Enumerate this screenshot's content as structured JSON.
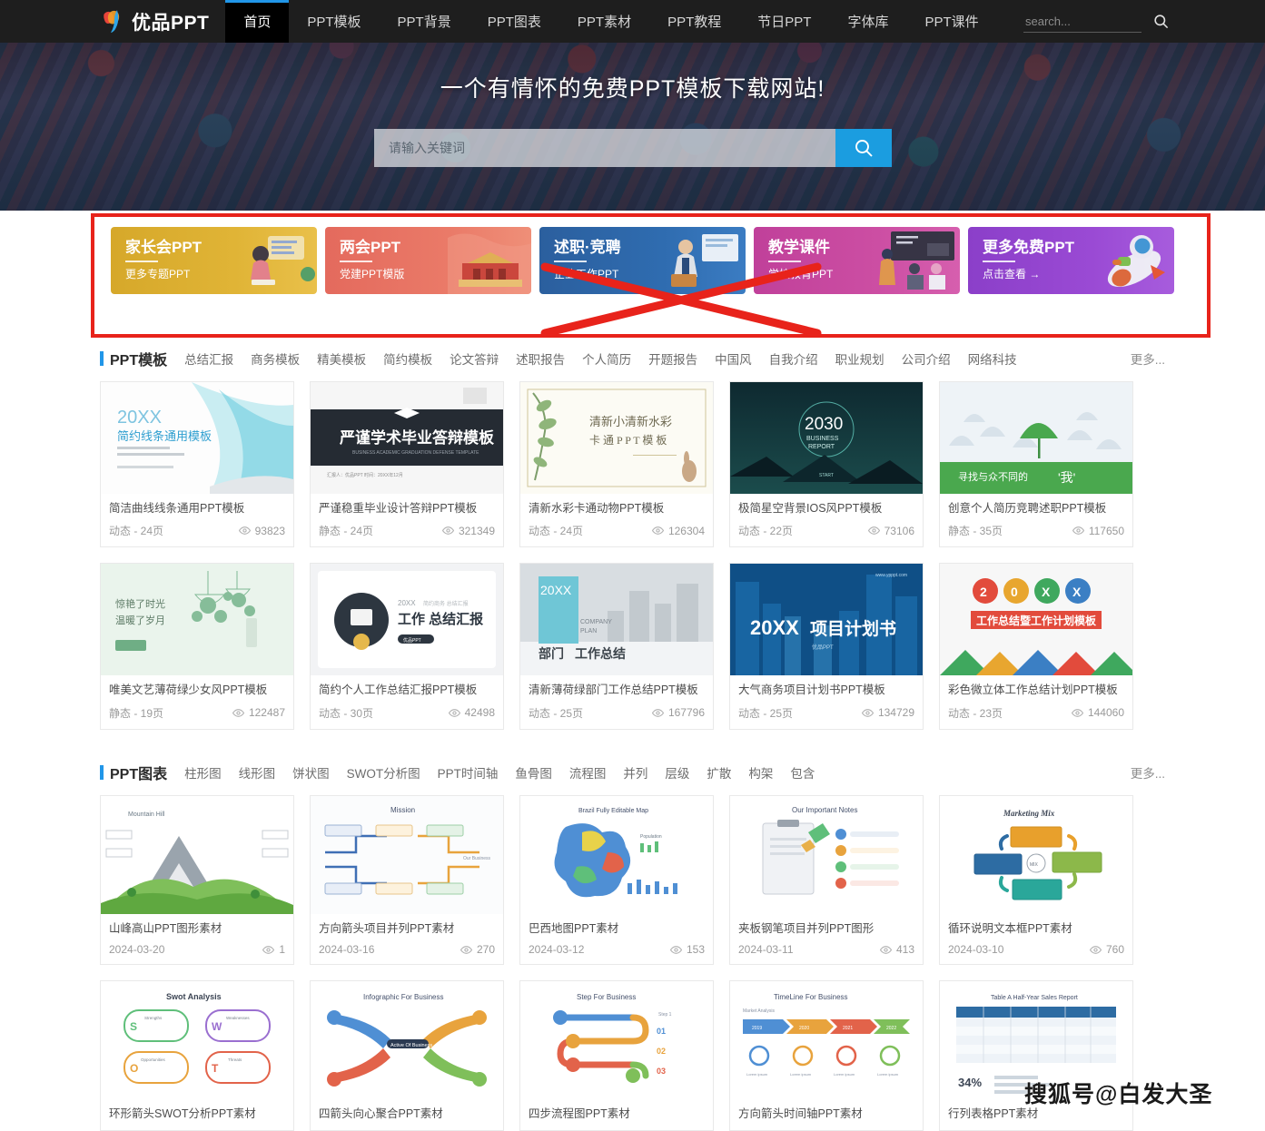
{
  "site": {
    "logo_text": "优品PPT",
    "logo_icon": "logo-mark-icon"
  },
  "topnav": {
    "items": [
      {
        "label": "首页",
        "active": true
      },
      {
        "label": "PPT模板",
        "active": false
      },
      {
        "label": "PPT背景",
        "active": false
      },
      {
        "label": "PPT图表",
        "active": false
      },
      {
        "label": "PPT素材",
        "active": false
      },
      {
        "label": "PPT教程",
        "active": false
      },
      {
        "label": "节日PPT",
        "active": false
      },
      {
        "label": "字体库",
        "active": false
      },
      {
        "label": "PPT课件",
        "active": false
      }
    ],
    "search_placeholder": "search...",
    "search_value": "",
    "search_icon": "search-icon"
  },
  "hero": {
    "title": "一个有情怀的免费PPT模板下载网站!",
    "search_placeholder": "请输入关键词",
    "search_value": "",
    "search_icon": "search-icon"
  },
  "promos": [
    {
      "title": "家长会PPT",
      "sub": "更多专题PPT",
      "color": "#dfb133",
      "art": "woman-laptop-icon"
    },
    {
      "title": "两会PPT",
      "sub": "党建PPT模版",
      "color": "#ea7a68",
      "art": "tiananmen-icon"
    },
    {
      "title": "述职·竞聘",
      "sub": "企业工作PPT",
      "color": "#2f6cb0",
      "art": "businessman-icon"
    },
    {
      "title": "教学课件",
      "sub": "学校教育PPT",
      "color": "#cc4ea3",
      "art": "classroom-icon"
    },
    {
      "title": "更多免费PPT",
      "sub": "点击查看 →",
      "color": "#9a4ad4",
      "art": "astronaut-rocket-icon"
    }
  ],
  "annotation": {
    "box_color": "#e8231b",
    "cross_color": "#e8231b"
  },
  "blocks": [
    {
      "title": "PPT模板",
      "tags": [
        "总结汇报",
        "商务模板",
        "精美模板",
        "简约模板",
        "论文答辩",
        "述职报告",
        "个人简历",
        "开题报告",
        "中国风",
        "自我介绍",
        "职业规划",
        "公司介绍",
        "网络科技"
      ],
      "more": "更多...",
      "cards": [
        {
          "title": "简洁曲线线条通用PPT模板",
          "meta": "动态 - 24页",
          "views": "93823",
          "thumb": "curve-lines-blue"
        },
        {
          "title": "严谨稳重毕业设计答辩PPT模板",
          "meta": "静态 - 24页",
          "views": "321349",
          "thumb": "graduation-dark"
        },
        {
          "title": "清新水彩卡通动物PPT模板",
          "meta": "动态 - 24页",
          "views": "126304",
          "thumb": "watercolor-animal"
        },
        {
          "title": "极简星空背景IOS风PPT模板",
          "meta": "动态 - 22页",
          "views": "73106",
          "thumb": "starry-2030"
        },
        {
          "title": "创意个人简历竞聘述职PPT模板",
          "meta": "静态 - 35页",
          "views": "117650",
          "thumb": "green-umbrella"
        },
        {
          "title": "唯美文艺薄荷绿少女风PPT模板",
          "meta": "静态 - 19页",
          "views": "122487",
          "thumb": "mint-girl"
        },
        {
          "title": "简约个人工作总结汇报PPT模板",
          "meta": "动态 - 30页",
          "views": "42498",
          "thumb": "work-summary"
        },
        {
          "title": "清新薄荷绿部门工作总结PPT模板",
          "meta": "动态 - 25页",
          "views": "167796",
          "thumb": "company-plan"
        },
        {
          "title": "大气商务项目计划书PPT模板",
          "meta": "动态 - 25页",
          "views": "134729",
          "thumb": "blue-city"
        },
        {
          "title": "彩色微立体工作总结计划PPT模板",
          "meta": "动态 - 23页",
          "views": "144060",
          "thumb": "colorful-20xx"
        }
      ]
    },
    {
      "title": "PPT图表",
      "tags": [
        "柱形图",
        "线形图",
        "饼状图",
        "SWOT分析图",
        "PPT时间轴",
        "鱼骨图",
        "流程图",
        "并列",
        "层级",
        "扩散",
        "构架",
        "包含"
      ],
      "more": "更多...",
      "cards": [
        {
          "title": "山峰高山PPT图形素材",
          "meta": "2024-03-20",
          "views": "1",
          "thumb": "mountain-hill"
        },
        {
          "title": "方向箭头项目并列PPT素材",
          "meta": "2024-03-16",
          "views": "270",
          "thumb": "mission-arrows"
        },
        {
          "title": "巴西地图PPT素材",
          "meta": "2024-03-12",
          "views": "153",
          "thumb": "brazil-map"
        },
        {
          "title": "夹板钢笔项目并列PPT图形",
          "meta": "2024-03-11",
          "views": "413",
          "thumb": "clipboard-notes"
        },
        {
          "title": "循环说明文本框PPT素材",
          "meta": "2024-03-10",
          "views": "760",
          "thumb": "marketing-mix"
        },
        {
          "title": "环形箭头SWOT分析PPT素材",
          "meta": "",
          "views": "",
          "thumb": "swot-analysis"
        },
        {
          "title": "四箭头向心聚合PPT素材",
          "meta": "",
          "views": "",
          "thumb": "infographic-business"
        },
        {
          "title": "四步流程图PPT素材",
          "meta": "",
          "views": "",
          "thumb": "step-business"
        },
        {
          "title": "方向箭头时间轴PPT素材",
          "meta": "",
          "views": "",
          "thumb": "timeline-business"
        },
        {
          "title": "行列表格PPT素材",
          "meta": "",
          "views": "",
          "thumb": "table-report"
        }
      ]
    }
  ],
  "watermark": {
    "text": "搜狐号@白发大圣"
  }
}
